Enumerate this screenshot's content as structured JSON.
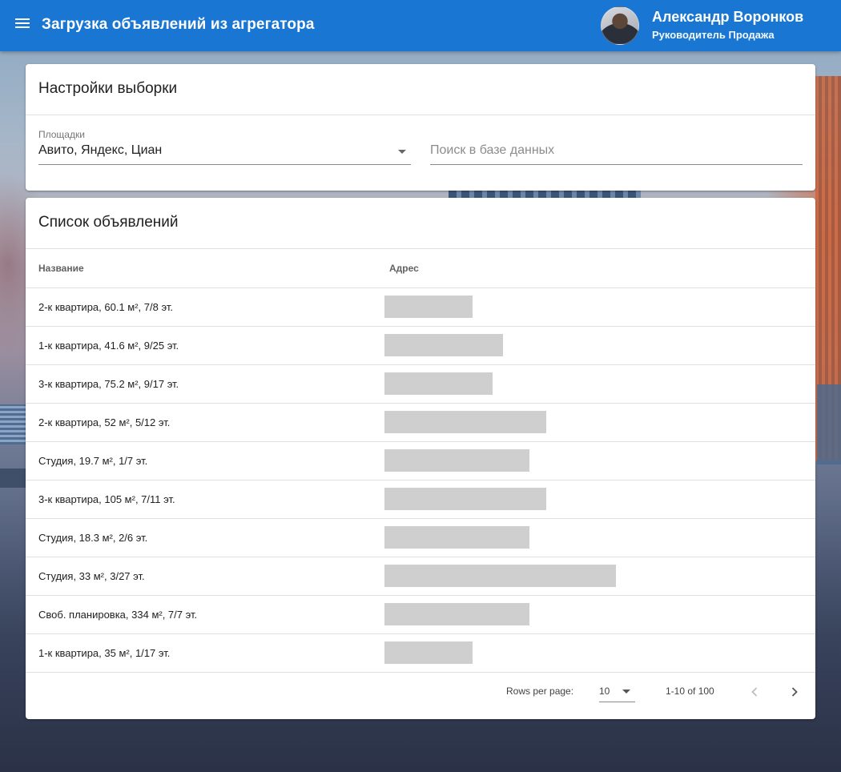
{
  "app": {
    "title": "Загрузка объявлений из агрегатора",
    "user_name": "Александр Воронков",
    "user_role": "Руководитель Продажа"
  },
  "filters": {
    "title": "Настройки выборки",
    "platforms_label": "Площадки",
    "platforms_value": "Авито, Яндекс, Циан",
    "search_placeholder": "Поиск в базе данных"
  },
  "listings": {
    "title": "Список объявлений",
    "columns": [
      "Название",
      "Адрес"
    ],
    "rows": [
      {
        "name": "2-к квартира, 60.1 м², 7/8 эт.",
        "address_redacted": 110
      },
      {
        "name": "1-к квартира, 41.6 м², 9/25 эт.",
        "address_redacted": 148
      },
      {
        "name": "3-к квартира, 75.2 м², 9/17 эт.",
        "address_redacted": 135
      },
      {
        "name": "2-к квартира, 52 м², 5/12 эт.",
        "address_redacted": 202
      },
      {
        "name": "Студия, 19.7 м², 1/7 эт.",
        "address_redacted": 181
      },
      {
        "name": "3-к квартира, 105 м², 7/11 эт.",
        "address_redacted": 202
      },
      {
        "name": "Студия, 18.3 м², 2/6 эт.",
        "address_redacted": 181
      },
      {
        "name": "Студия, 33 м², 3/27 эт.",
        "address_redacted": 289
      },
      {
        "name": "Своб. планировка, 334 м², 7/7 эт.",
        "address_redacted": 181
      },
      {
        "name": "1-к квартира, 35 м², 1/17 эт.",
        "address_redacted": 110
      }
    ]
  },
  "pagination": {
    "rows_per_page_label": "Rows per page:",
    "rows_per_page_value": "10",
    "range_text": "1-10 of 100"
  },
  "colors": {
    "appbar": "#1976d2",
    "redaction": "#cfcfcf"
  }
}
